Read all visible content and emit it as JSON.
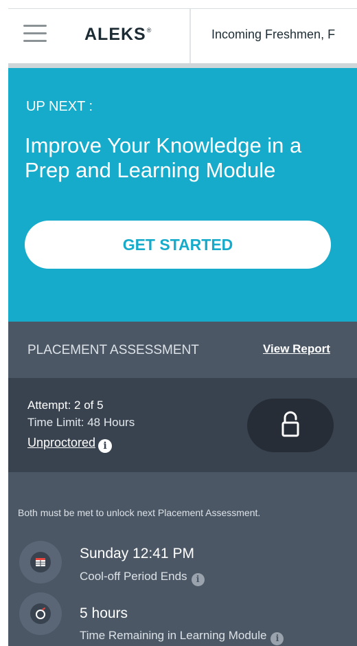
{
  "header": {
    "logo": "ALEKS",
    "logo_mark": "®",
    "class_name": "Incoming Freshmen, F"
  },
  "hero": {
    "label": "UP NEXT :",
    "title": "Improve Your Knowledge in a Prep and Learning Module",
    "button_label": "GET STARTED"
  },
  "placement": {
    "title": "PLACEMENT ASSESSMENT",
    "view_report_label": "View Report",
    "attempt": "Attempt: 2 of 5",
    "time_limit": "Time Limit: 48 Hours",
    "proctor_status": "Unproctored",
    "info_glyph": "i",
    "lock_icon": "unlock-icon"
  },
  "conditions": {
    "note": "Both must be met to unlock next Placement Assessment.",
    "items": [
      {
        "icon": "calendar-icon",
        "title": "Sunday 12:41 PM",
        "subtitle": "Cool-off Period Ends"
      },
      {
        "icon": "timer-icon",
        "title": "5 hours",
        "subtitle": "Time Remaining in Learning Module"
      }
    ]
  },
  "colors": {
    "accent": "#16abca",
    "panel": "#4b5765",
    "panel_dark": "#394350",
    "button_dark": "#262d36",
    "calendar_red": "#e8453c"
  }
}
